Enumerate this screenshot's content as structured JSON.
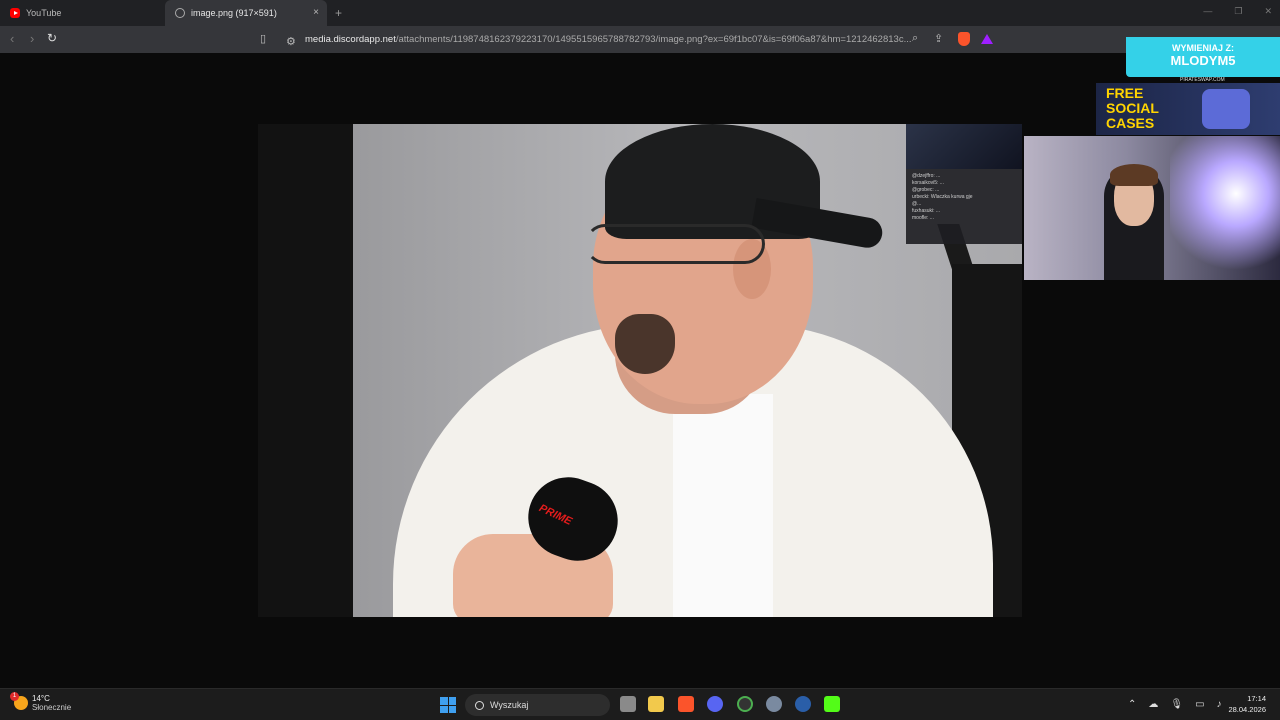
{
  "browser": {
    "tabs": [
      {
        "title": "YouTube",
        "active": false
      },
      {
        "title": "image.png (917×591)",
        "active": true
      }
    ],
    "new_tab": "+",
    "close_tab": "×",
    "url_host": "media.discordapp.net",
    "url_path": "/attachments/1198748162379223170/1495515965788782793/image.png?ex=69f1bc07&is=69f06a87&hm=1212462813c..."
  },
  "overlay": {
    "swap_line1": "WYMIENIAJ Z:",
    "swap_line2": "MLODYM5",
    "swap_site": "PIRATESWAP.COM",
    "cases_line1": "FREE",
    "cases_line2": "SOCIAL",
    "cases_line3": "CASES"
  },
  "photo": {
    "mic_label": "PRIME",
    "chat_lines": [
      "@dzejffro: ...",
      "korsaikovi5: ...",
      "@grobec: ...",
      "urbecki: Wlaczka kurwa gje",
      "@...",
      "fuxhasuki: ...",
      "moofle: ..."
    ]
  },
  "taskbar": {
    "weather_temp": "14°C",
    "weather_desc": "Słonecznie",
    "weather_badge": "1",
    "search_placeholder": "Wyszukaj",
    "time": "17:14",
    "date": "28.04.2026"
  },
  "colors": {
    "brave": "#fb542b",
    "overlay_cyan": "#34d1e8",
    "cases_yellow": "#ffd400",
    "windows_blue": "#3fa0f0"
  }
}
